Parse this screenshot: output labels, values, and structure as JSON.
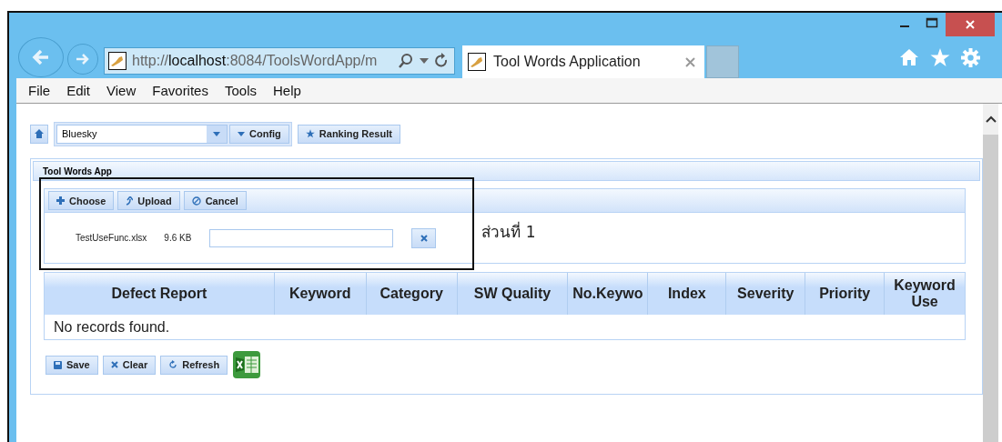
{
  "browser": {
    "address_bar": {
      "value": "http://**localhost**:8084/ToolsWordApp/m"
    },
    "tabs": [
      {
        "title": "Tool Words Application",
        "selected": true
      }
    ],
    "menu": [
      "File",
      "Edit",
      "View",
      "Favorites",
      "Tools",
      "Help"
    ]
  },
  "toolbar": {
    "theme_select": {
      "value": "Bluesky"
    },
    "config_button": "Config",
    "ranking_button": "Ranking Result"
  },
  "panel": {
    "title": "Tool Words App",
    "upload": {
      "buttons": [
        {
          "kind": "choose",
          "label": "Choose"
        },
        {
          "kind": "upload",
          "label": "Upload"
        },
        {
          "kind": "cancel",
          "label": "Cancel"
        }
      ],
      "files": [
        {
          "name": "TestUseFunc.xlsx",
          "size": "9.6 KB"
        }
      ]
    },
    "annotation": "ส่วนที่ 1",
    "table": {
      "columns": [
        "Defect Report",
        "Keyword",
        "Category",
        "SW Quality",
        "No.Keywo",
        "Index",
        "Severity",
        "Priority",
        "Keyword Use"
      ],
      "empty_message": "No records found."
    },
    "buttons": [
      {
        "kind": "save",
        "label": "Save"
      },
      {
        "kind": "clear",
        "label": "Clear"
      },
      {
        "kind": "refresh",
        "label": "Refresh"
      }
    ]
  }
}
